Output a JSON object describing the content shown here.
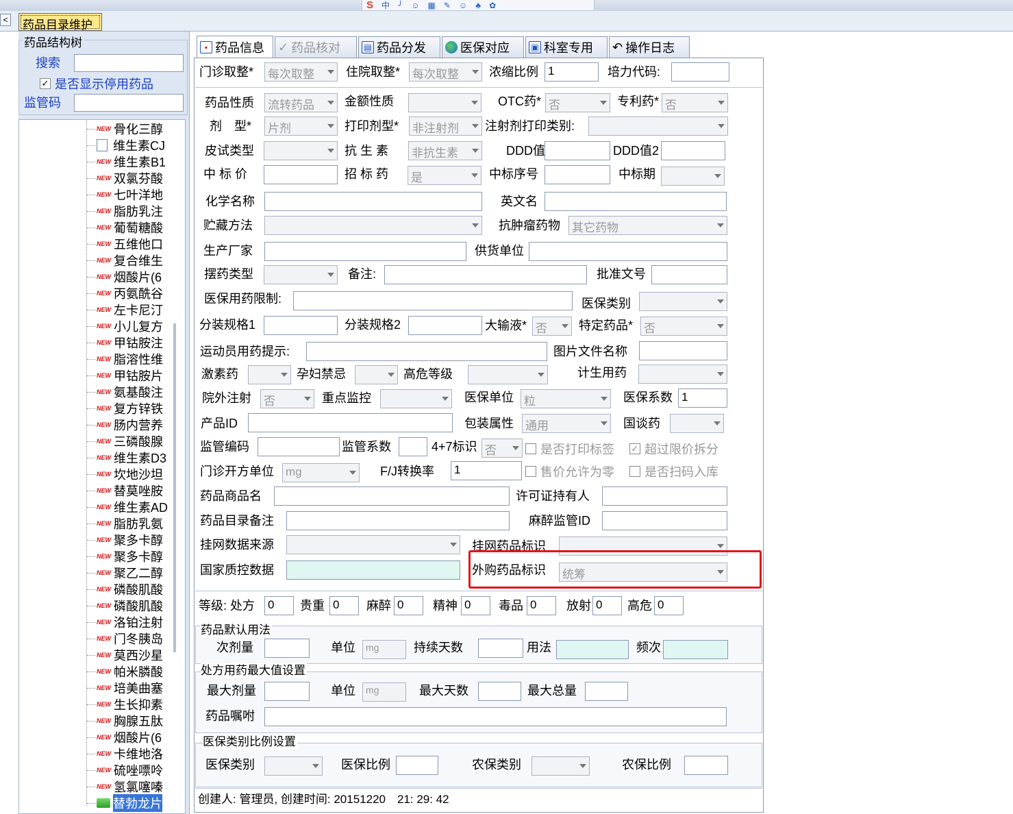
{
  "sogou": {
    "logo": "S",
    "items": [
      "中",
      "╯",
      "☺",
      "▦",
      "✎",
      "☺",
      "♣",
      "✿"
    ]
  },
  "window": {
    "doc_tab": "药品目录维护",
    "left_arrow": "<"
  },
  "left": {
    "tree_title": "药品结构树",
    "search_label": "搜索",
    "show_disabled_label": "是否显示停用药品",
    "show_disabled_checked": true,
    "supervise_label": "监管码",
    "tree_items": [
      {
        "tag": "NEW",
        "name": "骨化三醇"
      },
      {
        "tag": "doc",
        "name": "维生素CJ"
      },
      {
        "tag": "NEW",
        "name": "维生素B1"
      },
      {
        "tag": "NEW",
        "name": "双氯芬酸"
      },
      {
        "tag": "NEW",
        "name": "七叶洋地"
      },
      {
        "tag": "NEW",
        "name": "脂肪乳注"
      },
      {
        "tag": "NEW",
        "name": "葡萄糖酸"
      },
      {
        "tag": "NEW",
        "name": "五维他口"
      },
      {
        "tag": "NEW",
        "name": "复合维生"
      },
      {
        "tag": "NEW",
        "name": "烟酸片(6"
      },
      {
        "tag": "NEW",
        "name": "丙氨酰谷"
      },
      {
        "tag": "NEW",
        "name": "左卡尼汀"
      },
      {
        "tag": "NEW",
        "name": "小儿复方"
      },
      {
        "tag": "NEW",
        "name": "甲钴胺注"
      },
      {
        "tag": "NEW",
        "name": "脂溶性维"
      },
      {
        "tag": "NEW",
        "name": "甲钴胺片"
      },
      {
        "tag": "NEW",
        "name": "氨基酸注"
      },
      {
        "tag": "NEW",
        "name": "复方锌铁"
      },
      {
        "tag": "NEW",
        "name": "肠内营养"
      },
      {
        "tag": "NEW",
        "name": "三磷酸腺"
      },
      {
        "tag": "NEW",
        "name": "维生素D3"
      },
      {
        "tag": "NEW",
        "name": "坎地沙坦"
      },
      {
        "tag": "NEW",
        "name": "替莫唑胺"
      },
      {
        "tag": "NEW",
        "name": "维生素AD"
      },
      {
        "tag": "NEW",
        "name": "脂肪乳氨"
      },
      {
        "tag": "NEW",
        "name": "聚多卡醇"
      },
      {
        "tag": "NEW",
        "name": "聚多卡醇"
      },
      {
        "tag": "NEW",
        "name": "聚乙二醇"
      },
      {
        "tag": "NEW",
        "name": "磷酸肌酸"
      },
      {
        "tag": "NEW",
        "name": "磷酸肌酸"
      },
      {
        "tag": "NEW",
        "name": "洛铂注射"
      },
      {
        "tag": "NEW",
        "name": "门冬胰岛"
      },
      {
        "tag": "NEW",
        "name": "莫西沙星"
      },
      {
        "tag": "NEW",
        "name": "帕米膦酸"
      },
      {
        "tag": "NEW",
        "name": "培美曲塞"
      },
      {
        "tag": "NEW",
        "name": "生长抑素"
      },
      {
        "tag": "NEW",
        "name": "胸腺五肽"
      },
      {
        "tag": "NEW",
        "name": "烟酸片(6"
      },
      {
        "tag": "NEW",
        "name": "卡维地洛"
      },
      {
        "tag": "NEW",
        "name": "硫唑嘌呤"
      },
      {
        "tag": "NEW",
        "name": "氢氯噻嗪"
      },
      {
        "tag": "folder",
        "name": "替勃龙片"
      }
    ]
  },
  "tabs": [
    "药品信息",
    "药品核对",
    "药品分发",
    "医保对应",
    "科室专用",
    "操作日志"
  ],
  "form": {
    "outpatient_round": "门诊取整*",
    "outpatient_round_val": "每次取整",
    "inpatient_round": "住院取整*",
    "inpatient_round_val": "每次取整",
    "conc_ratio": "浓缩比例",
    "conc_ratio_val": "1",
    "peili_code": "培力代码:",
    "drug_nature": "药品性质",
    "drug_nature_val": "流转药品",
    "amount_nature": "金额性质",
    "otc": "OTC药*",
    "otc_val": "否",
    "patent": "专利药*",
    "patent_val": "否",
    "dosage": "剂　型*",
    "dosage_val": "片剂",
    "print_dosage": "打印剂型*",
    "print_dosage_val": "非注射剂",
    "inject_print": "注射剂打印类别:",
    "skin_test": "皮试类型",
    "antibiotic": "抗 生 素",
    "antibiotic_val": "非抗生素",
    "ddd": "DDD值",
    "ddd2": "DDD值2",
    "bid_price": "中 标 价",
    "bid_drug": "招 标 药",
    "bid_drug_val": "是",
    "bid_no": "中标序号",
    "bid_period": "中标期",
    "chem_name": "化学名称",
    "en_name": "英文名",
    "storage": "贮藏方法",
    "antitumor": "抗肿瘤药物",
    "antitumor_val": "其它药物",
    "manufacturer": "生产厂家",
    "supplier": "供货单位",
    "place_type": "摆药类型",
    "remark": "备注:",
    "approval": "批准文号",
    "insurance_limit": "医保用药限制:",
    "insurance_type": "医保类别",
    "pack_spec1": "分装规格1",
    "pack_spec2": "分装规格2",
    "large_infusion": "大输液*",
    "large_infusion_val": "否",
    "special_drug": "特定药品*",
    "special_drug_val": "否",
    "athlete": "运动员用药提示:",
    "image_file": "图片文件名称",
    "hormone": "激素药",
    "pregnancy": "孕妇禁忌",
    "risk_level": "高危等级",
    "family_plan": "计生用药",
    "external_inject": "院外注射",
    "external_inject_val": "否",
    "key_monitor": "重点监控",
    "ins_unit": "医保单位",
    "ins_unit_val": "粒",
    "ins_coef": "医保系数",
    "ins_coef_val": "1",
    "product_id": "产品ID",
    "pack_attr": "包装属性",
    "pack_attr_val": "通用",
    "negotiated": "国谈药",
    "sup_code": "监管编码",
    "sup_coef": "监管系数",
    "four_seven": "4+7标识",
    "four_seven_val": "否",
    "print_label": "是否打印标签",
    "over_limit": "超过限价拆分",
    "op_unit": "门诊开方单位",
    "op_unit_val": "mg",
    "fj_ratio": "F/J转换率",
    "fj_ratio_val": "1",
    "price_zero": "售价允许为零",
    "scan_in": "是否扫码入库",
    "trade_name": "药品商品名",
    "license_holder": "许可证持有人",
    "catalog_remark": "药品目录备注",
    "anesthesia_id": "麻醉监管ID",
    "net_source": "挂网数据来源",
    "net_flag": "挂网药品标识",
    "national_qc": "国家质控数据",
    "purchase_flag": "外购药品标识",
    "purchase_flag_val": "统筹",
    "grade": "等级: 处方",
    "grade_val": "0",
    "precious": "贵重",
    "precious_val": "0",
    "anesthetic": "麻醉",
    "anesthetic_val": "0",
    "mental": "精神",
    "mental_val": "0",
    "toxic": "毒品",
    "toxic_val": "0",
    "radio": "放射",
    "radio_val": "0",
    "high_risk": "高危",
    "high_risk_val": "0"
  },
  "default_usage": {
    "title": "药品默认用法",
    "dose": "次剂量",
    "unit": "单位",
    "unit_val": "mg",
    "days": "持续天数",
    "usage": "用法",
    "freq": "频次"
  },
  "max_settings": {
    "title": "处方用药最大值设置",
    "max_dose": "最大剂量",
    "unit": "单位",
    "unit_val": "mg",
    "max_days": "最大天数",
    "max_total": "最大总量",
    "advice": "药品嘱咐"
  },
  "insurance_ratio": {
    "title": "医保类别比例设置",
    "ins_type": "医保类别",
    "ins_ratio": "医保比例",
    "farm_type": "农保类别",
    "farm_ratio": "农保比例"
  },
  "footer": "创建人: 管理员, 创建时间: 20151220　21: 29: 42"
}
